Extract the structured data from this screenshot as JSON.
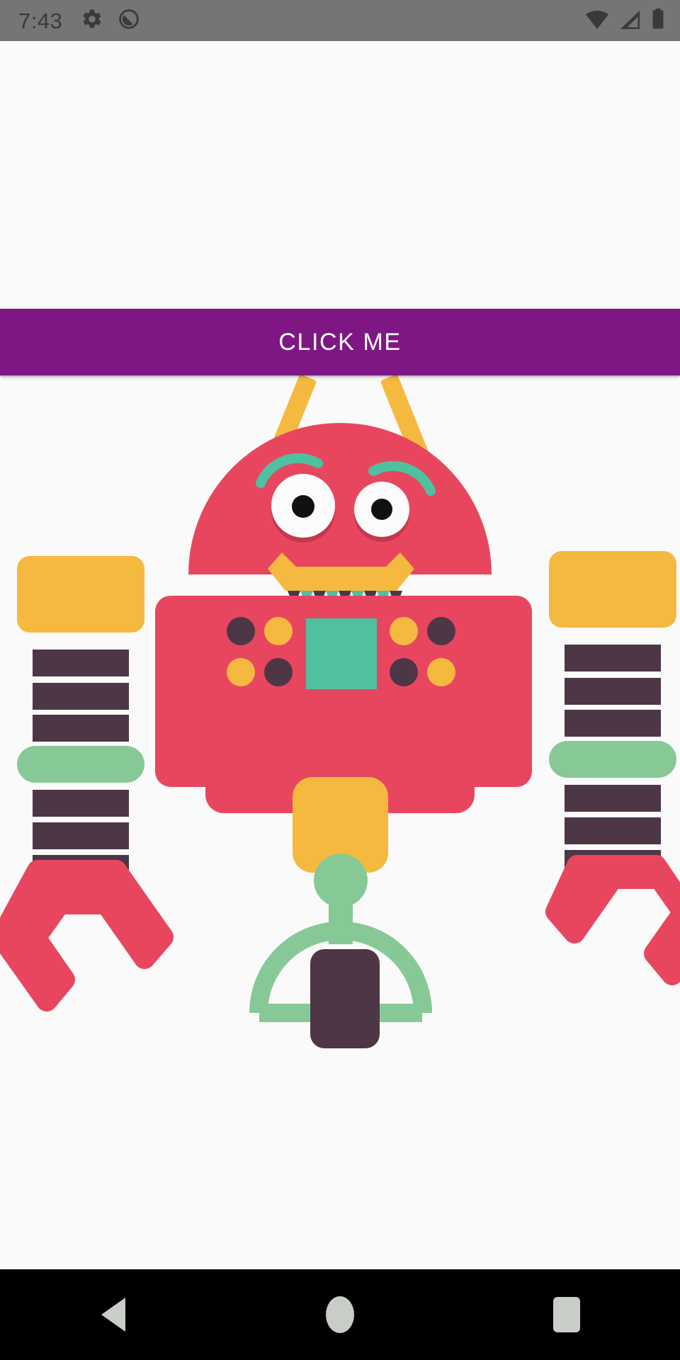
{
  "status_bar": {
    "time": "7:43",
    "background_color": "#757575",
    "icon_color": "#3a3a3a",
    "left_icons": [
      "gear-icon",
      "do-not-disturb-icon"
    ],
    "right_icons": [
      "wifi-icon",
      "cellular-signal-icon",
      "battery-icon"
    ]
  },
  "main": {
    "background_color": "#fafafa",
    "button": {
      "label": "CLICK ME",
      "background_color": "#7e1783",
      "text_color": "#ffffff"
    },
    "illustration": {
      "name": "robot-illustration",
      "palette": {
        "pink": "#e8465f",
        "pink_shadow": "#c4374f",
        "orange": "#f5b940",
        "teal": "#4fc0a0",
        "green": "#86c997",
        "dark": "#4d3646",
        "white": "#fbfbfb",
        "black": "#111111"
      },
      "parts": {
        "head": "semicircle-dome",
        "antennae": 2,
        "eyebrows": 2,
        "eyes": 2,
        "mouth": "open-u-shape",
        "teeth_count": 9,
        "teeth_pattern": [
          "dark",
          "teal",
          "dark",
          "teal",
          "dark",
          "teal",
          "dark",
          "teal",
          "dark"
        ],
        "torso_buttons": 8,
        "torso_button_pattern": [
          "dark",
          "orange",
          "orange",
          "dark",
          "orange",
          "dark",
          "dark",
          "orange"
        ],
        "torso_screen": "teal-square",
        "arm_segments_per_arm": 6,
        "arm_shoulder": "orange-rounded-rect",
        "arm_elbow": "green-rounded-bar",
        "hands": "pink-claw",
        "pelvis": "orange-rounded-rect",
        "base": "green-arch-with-dark-block"
      }
    }
  },
  "nav_bar": {
    "background_color": "#000000",
    "icon_color": "#c9cdc8",
    "buttons": [
      {
        "name": "back",
        "icon": "triangle-left-icon"
      },
      {
        "name": "home",
        "icon": "circle-icon"
      },
      {
        "name": "recents",
        "icon": "square-icon"
      }
    ]
  }
}
